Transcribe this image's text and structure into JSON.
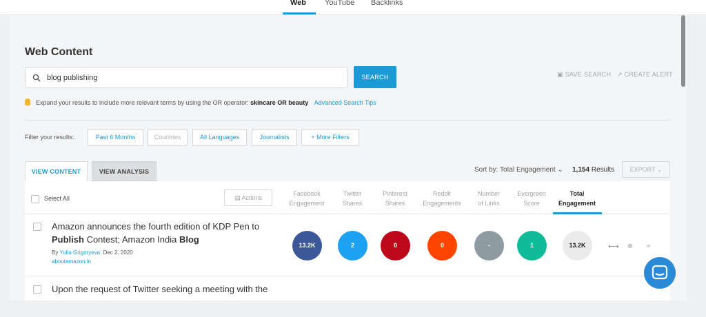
{
  "top_tabs": [
    {
      "label": "Web",
      "active": true
    },
    {
      "label": "YouTube",
      "active": false
    },
    {
      "label": "Backlinks",
      "active": false
    }
  ],
  "page_title": "Web Content",
  "search": {
    "value": "blog publishing",
    "button": "SEARCH"
  },
  "header_actions": {
    "save_search": "SAVE SEARCH",
    "create_alert": "CREATE ALERT"
  },
  "tip": {
    "text": "Expand your results to include more relevant terms by using the OR operator:",
    "example": "skincare OR beauty",
    "link": "Advanced Search Tips"
  },
  "filters": {
    "label": "Filter your results:",
    "buttons": [
      "Past 6 Months",
      "Countries",
      "All Languages",
      "Journalists",
      "+  More Filters"
    ]
  },
  "view_tabs": {
    "content": "VIEW CONTENT",
    "analysis": "VIEW ANALYSIS"
  },
  "sort": {
    "label": "Sort by: Total Engagement",
    "count": "1,154",
    "results_label": "Results",
    "export": "EXPORT"
  },
  "table": {
    "select_all": "Select All",
    "actions": "Actions",
    "columns": [
      {
        "line1": "Facebook",
        "line2": "Engagement"
      },
      {
        "line1": "Twitter",
        "line2": "Shares"
      },
      {
        "line1": "Pinterest",
        "line2": "Shares"
      },
      {
        "line1": "Reddit",
        "line2": "Engagements"
      },
      {
        "line1": "Number",
        "line2": "of Links"
      },
      {
        "line1": "Evergreen",
        "line2": "Score"
      },
      {
        "line1": "Total",
        "line2": "Engagement"
      }
    ],
    "rows": [
      {
        "title_part1": "Amazon announces the fourth edition of KDP Pen to",
        "title_bold1": "Publish",
        "title_part2": " Contest; Amazon India ",
        "title_bold2": "Blog",
        "by": "By",
        "author": "Yulia Grigoryeva",
        "date": "Dec 2, 2020",
        "domain": "aboutamazon.in",
        "metrics": [
          "13.2K",
          "2",
          "0",
          "0",
          "-",
          "1",
          "13.2K"
        ],
        "metric_colors": [
          "#3b5998",
          "#1da1f2",
          "#bd081c",
          "#ff4500",
          "#8e9ba3",
          "#10bb9a",
          "#ebebeb"
        ]
      },
      {
        "title_part1": "Upon the request of Twitter seeking a meeting with the"
      }
    ]
  },
  "colors": {
    "accent": "#1b9ad6",
    "chat": "#2b8ad8"
  }
}
